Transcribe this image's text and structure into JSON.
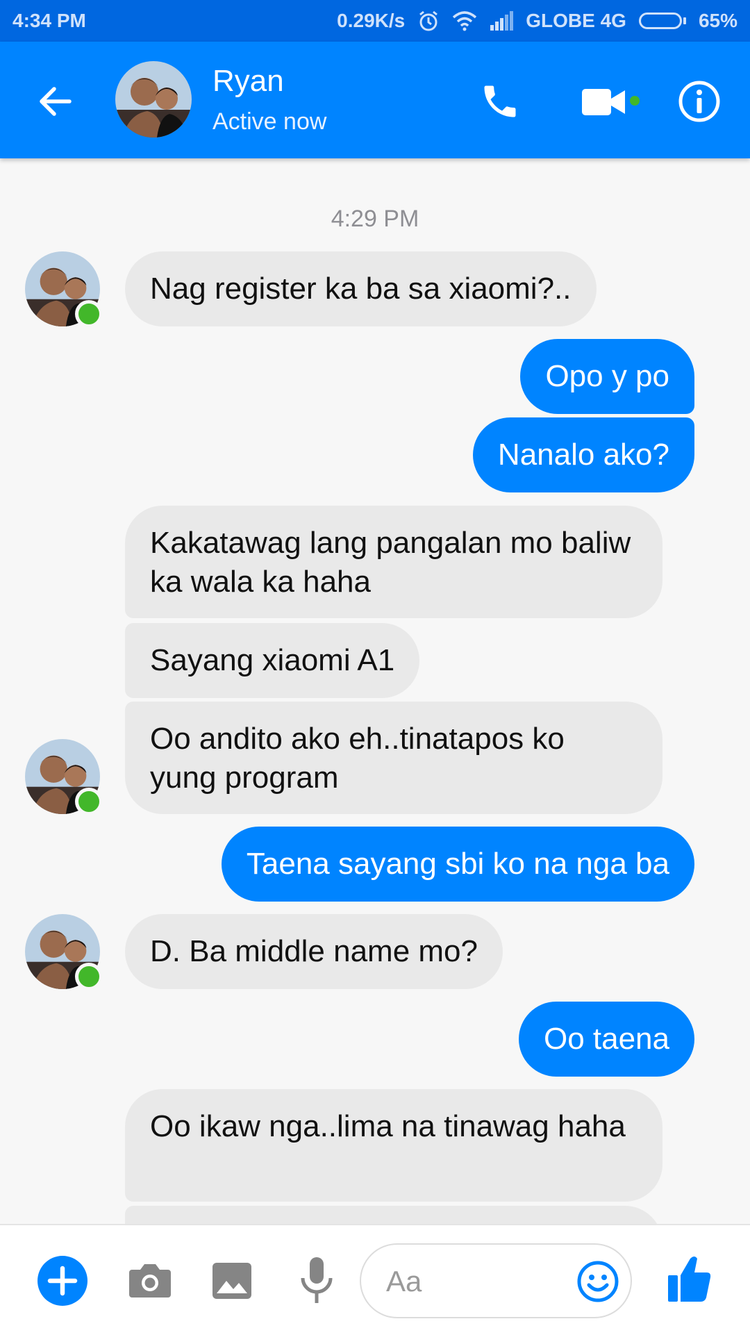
{
  "status_bar": {
    "time": "4:34 PM",
    "network_speed": "0.29K/s",
    "carrier": "GLOBE 4G",
    "battery": "65%",
    "battery_level": 0.65,
    "icons": [
      "alarm-icon",
      "wifi-icon",
      "signal-icon",
      "battery-icon"
    ]
  },
  "header": {
    "name": "Ryan",
    "status": "Active now",
    "icons": [
      "back-arrow-icon",
      "phone-icon",
      "video-camera-icon",
      "info-icon"
    ]
  },
  "conversation": {
    "timestamp": "4:29 PM",
    "messages": [
      {
        "from": "them",
        "text": "Nag register ka ba sa xiaomi?.."
      },
      {
        "from": "me",
        "text": "Opo y po"
      },
      {
        "from": "me",
        "text": "Nanalo ako?"
      },
      {
        "from": "them",
        "text": "Kakatawag lang pangalan mo baliw ka wala ka haha"
      },
      {
        "from": "them",
        "text": "Sayang xiaomi A1"
      },
      {
        "from": "them",
        "text": "Oo andito ako eh..tinatapos ko yung program"
      },
      {
        "from": "me",
        "text": "Taena sayang sbi ko na nga ba"
      },
      {
        "from": "them",
        "text": "D. Ba middle name mo?"
      },
      {
        "from": "me",
        "text": "Oo taena"
      },
      {
        "from": "them",
        "text": "Oo ikaw nga..lima na tinawag haha"
      }
    ]
  },
  "composer": {
    "placeholder": "Aa",
    "icons": [
      "plus-icon",
      "camera-icon",
      "gallery-icon",
      "microphone-icon",
      "emoji-icon",
      "thumbs-up-icon"
    ]
  },
  "colors": {
    "brand_blue": "#0084ff",
    "status_bar_blue": "#0067e0",
    "incoming_bubble": "#e9e9e9",
    "presence_green": "#42b72a"
  }
}
